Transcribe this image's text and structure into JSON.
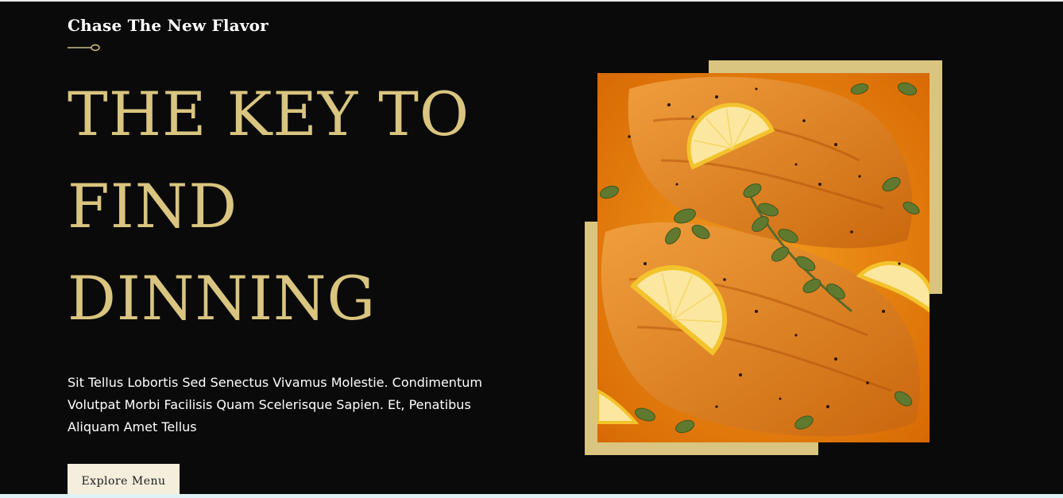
{
  "hero": {
    "tagline": "Chase The New Flavor",
    "headline_lines": [
      "THE KEY TO",
      "FIND",
      "DINNING"
    ],
    "description": "Sit Tellus Lobortis Sed Senectus Vivamus Molestie. Condimentum Volutpat Morbi Facilisis Quam Scelerisque Sapien. Et, Penatibus Aliquam Amet Tellus",
    "button_label": "Explore Menu"
  },
  "colors": {
    "background": "#0a0a0a",
    "accent_gold": "#d9c57f",
    "button_bg": "#f5eedd",
    "text_white": "#ffffff"
  },
  "icons": {
    "divider": "spoon-icon"
  }
}
